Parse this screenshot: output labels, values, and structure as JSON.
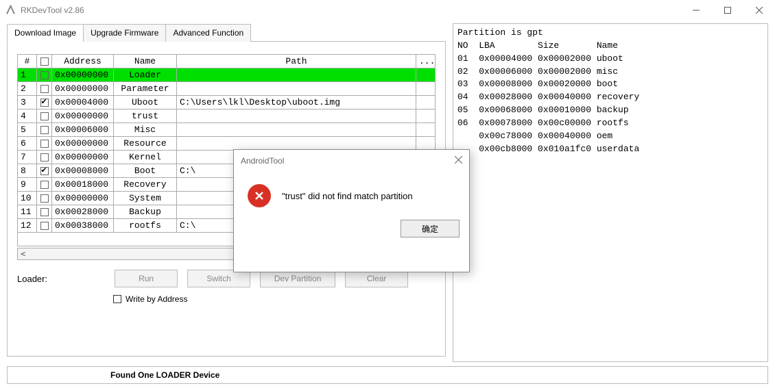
{
  "window": {
    "title": "RKDevTool v2.86"
  },
  "tabs": [
    {
      "label": "Download Image",
      "active": true
    },
    {
      "label": "Upgrade Firmware",
      "active": false
    },
    {
      "label": "Advanced Function",
      "active": false
    }
  ],
  "table": {
    "heads": {
      "idx": "#",
      "chk": "",
      "addr": "Address",
      "name": "Name",
      "path": "Path",
      "dots": "..."
    },
    "rows": [
      {
        "idx": "1",
        "checked": false,
        "addr": "0x00000000",
        "name": "Loader",
        "path": "",
        "highlight": true
      },
      {
        "idx": "2",
        "checked": false,
        "addr": "0x00000000",
        "name": "Parameter",
        "path": ""
      },
      {
        "idx": "3",
        "checked": true,
        "addr": "0x00004000",
        "name": "Uboot",
        "path": "C:\\Users\\lkl\\Desktop\\uboot.img"
      },
      {
        "idx": "4",
        "checked": false,
        "addr": "0x00000000",
        "name": "trust",
        "path": ""
      },
      {
        "idx": "5",
        "checked": false,
        "addr": "0x00006000",
        "name": "Misc",
        "path": ""
      },
      {
        "idx": "6",
        "checked": false,
        "addr": "0x00000000",
        "name": "Resource",
        "path": ""
      },
      {
        "idx": "7",
        "checked": false,
        "addr": "0x00000000",
        "name": "Kernel",
        "path": ""
      },
      {
        "idx": "8",
        "checked": true,
        "addr": "0x00008000",
        "name": "Boot",
        "path": "C:\\"
      },
      {
        "idx": "9",
        "checked": false,
        "addr": "0x00018000",
        "name": "Recovery",
        "path": ""
      },
      {
        "idx": "10",
        "checked": false,
        "addr": "0x00000000",
        "name": "System",
        "path": ""
      },
      {
        "idx": "11",
        "checked": false,
        "addr": "0x00028000",
        "name": "Backup",
        "path": ""
      },
      {
        "idx": "12",
        "checked": false,
        "addr": "0x00038000",
        "name": "rootfs",
        "path": "C:\\"
      }
    ]
  },
  "loader_label": "Loader:",
  "buttons": {
    "run": "Run",
    "switch": "Switch",
    "devpart": "Dev Partition",
    "clear": "Clear"
  },
  "write_by_address_label": "Write by Address",
  "status_text": "Found One LOADER Device",
  "log": {
    "header": "Partition is gpt",
    "cols": "NO  LBA        Size       Name",
    "lines": [
      "01  0x00004000 0x00002000 uboot",
      "02  0x00006000 0x00002000 misc",
      "03  0x00008000 0x00020000 boot",
      "04  0x00028000 0x00040000 recovery",
      "05  0x00068000 0x00010000 backup",
      "06  0x00078000 0x00c00000 rootfs",
      "    0x00c78000 0x00040000 oem",
      "    0x00cb8000 0x010a1fc0 userdata"
    ]
  },
  "dialog": {
    "title": "AndroidTool",
    "message": "\"trust\" did not find match partition",
    "ok": "确定"
  }
}
